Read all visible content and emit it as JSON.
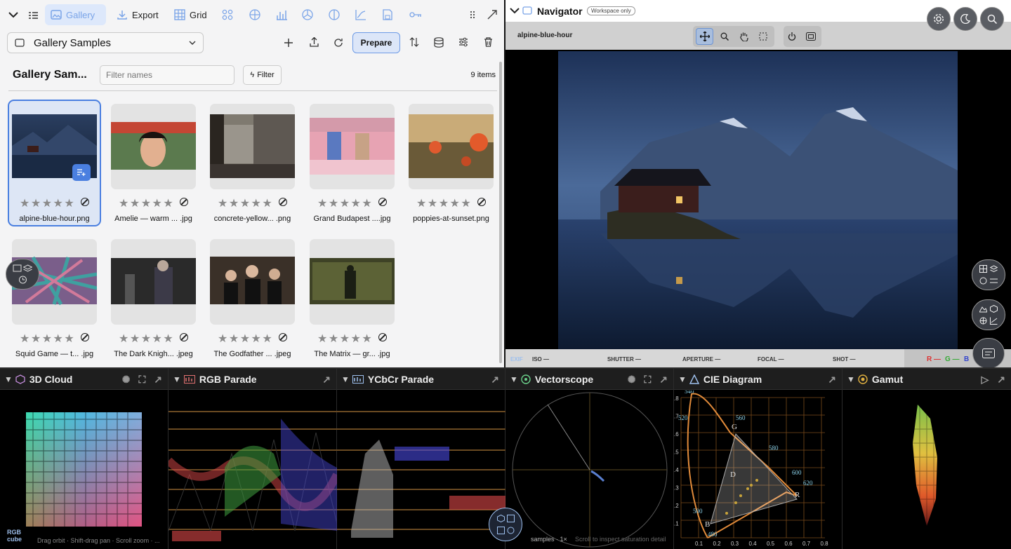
{
  "toolbar": {
    "gallery_label": "Gallery",
    "export_label": "Export",
    "grid_label": "Grid"
  },
  "collection": {
    "selected": "Gallery Samples",
    "prepare_label": "Prepare"
  },
  "gallery": {
    "title": "Gallery Sam...",
    "filter_placeholder": "Filter names",
    "filter_button": "Filter",
    "count": "9 items",
    "items": [
      {
        "name": "alpine-blue-hour.png",
        "selected": true
      },
      {
        "name": "Amelie — warm ... .jpg"
      },
      {
        "name": "concrete-yellow... .png"
      },
      {
        "name": "Grand Budapest ....jpg"
      },
      {
        "name": "poppies-at-sunset.png"
      },
      {
        "name": "Squid Game — t... .jpg"
      },
      {
        "name": "The Dark Knigh... .jpeg"
      },
      {
        "name": "The Godfather ... .jpeg"
      },
      {
        "name": "The Matrix — gr... .jpg"
      }
    ],
    "stars": "★★★★★"
  },
  "navigator": {
    "title": "Navigator",
    "badge": "Workspace only",
    "image_name": "alpine-blue-hour",
    "exif": {
      "tag": "EXIF",
      "iso": "ISO —",
      "shutter": "SHUTTER —",
      "aperture": "APERTURE —",
      "focal": "FOCAL —",
      "shot": "SHOT —",
      "r": "R —",
      "g": "G —",
      "b": "B"
    }
  },
  "panels": {
    "cloud": {
      "title": "3D Cloud",
      "caption1": "RGB",
      "caption2": "cube",
      "hint": "Drag orbit · Shift-drag pan · Scroll zoom · ..."
    },
    "rgb": {
      "title": "RGB Parade"
    },
    "ycbcr": {
      "title": "YCbCr Parade"
    },
    "vector": {
      "title": "Vectorscope",
      "footer": "samples · 1×",
      "hint": "Scroll to inspect saturation detail"
    },
    "cie": {
      "title": "CIE Diagram",
      "wavelengths": [
        "540",
        "520",
        "560",
        "580",
        "600",
        "620",
        "500",
        "480"
      ],
      "primaries": [
        "G",
        "R",
        "B",
        "D"
      ],
      "x_ticks": [
        "0.1",
        "0.2",
        "0.3",
        "0.4",
        "0.5",
        "0.6",
        "0.7",
        "0.8"
      ],
      "y_ticks": [
        ".8",
        ".7",
        ".6",
        ".5",
        ".4",
        ".3",
        ".2",
        ".1"
      ]
    },
    "gamut": {
      "title": "Gamut"
    }
  },
  "colors": {
    "accent": "#4a7fe0",
    "orange": "#c87a3a"
  }
}
